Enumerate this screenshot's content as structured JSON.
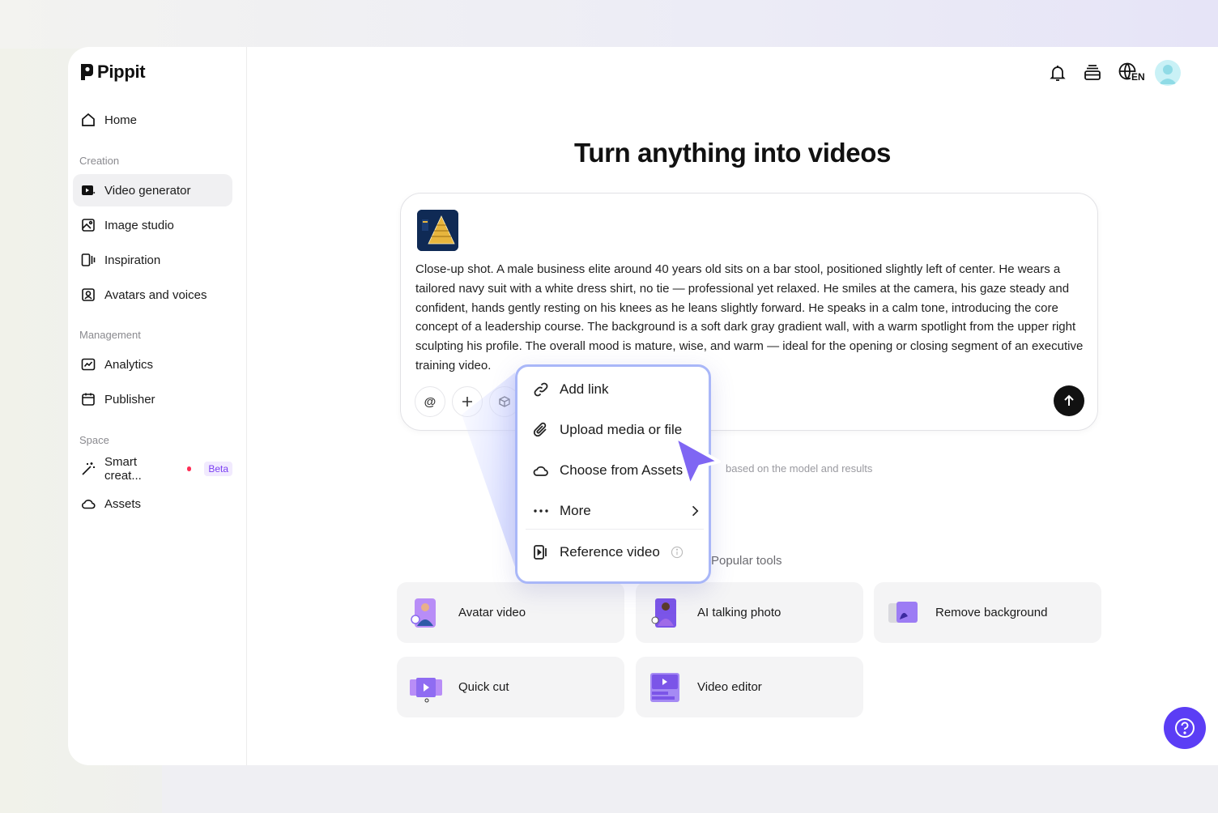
{
  "brand": {
    "name": "Pippit"
  },
  "sidebar": {
    "home": "Home",
    "sections": {
      "creation": "Creation",
      "management": "Management",
      "space": "Space"
    },
    "items": {
      "video_generator": "Video generator",
      "image_studio": "Image studio",
      "inspiration": "Inspiration",
      "avatars_voices": "Avatars and voices",
      "analytics": "Analytics",
      "publisher": "Publisher",
      "smart_creation": "Smart creat...",
      "assets": "Assets"
    },
    "beta_badge": "Beta"
  },
  "topbar": {
    "language": "EN"
  },
  "main": {
    "heading": "Turn anything into videos",
    "prompt": "Close-up shot. A male business elite around 40 years old sits on a bar stool, positioned slightly left of center. He wears a tailored navy suit with a white dress shirt, no tie — professional yet relaxed. He smiles at the camera, his gaze steady and confident, hands gently resting on his knees as he leans slightly forward. He speaks in a calm tone, introducing the core concept of a leadership course. The background is a soft dark gray gradient wall, with a warm spotlight from the upper right sculpting his profile. The overall mood is mature, wise, and warm — ideal for the opening or closing segment of an executive training video.",
    "mention_symbol": "@",
    "hint": "based on the model and results",
    "popular_tools_label": "Popular tools"
  },
  "menu": {
    "add_link": "Add link",
    "upload": "Upload media or file",
    "choose_assets": "Choose from Assets",
    "more": "More",
    "reference_video": "Reference video"
  },
  "tools": {
    "avatar_video": "Avatar video",
    "ai_talking_photo": "AI talking photo",
    "remove_background": "Remove background",
    "quick_cut": "Quick cut",
    "video_editor": "Video editor"
  },
  "colors": {
    "accent": "#5b3df5",
    "menu_border": "#a9b7f8",
    "beta_dot": "#ff2d55"
  }
}
